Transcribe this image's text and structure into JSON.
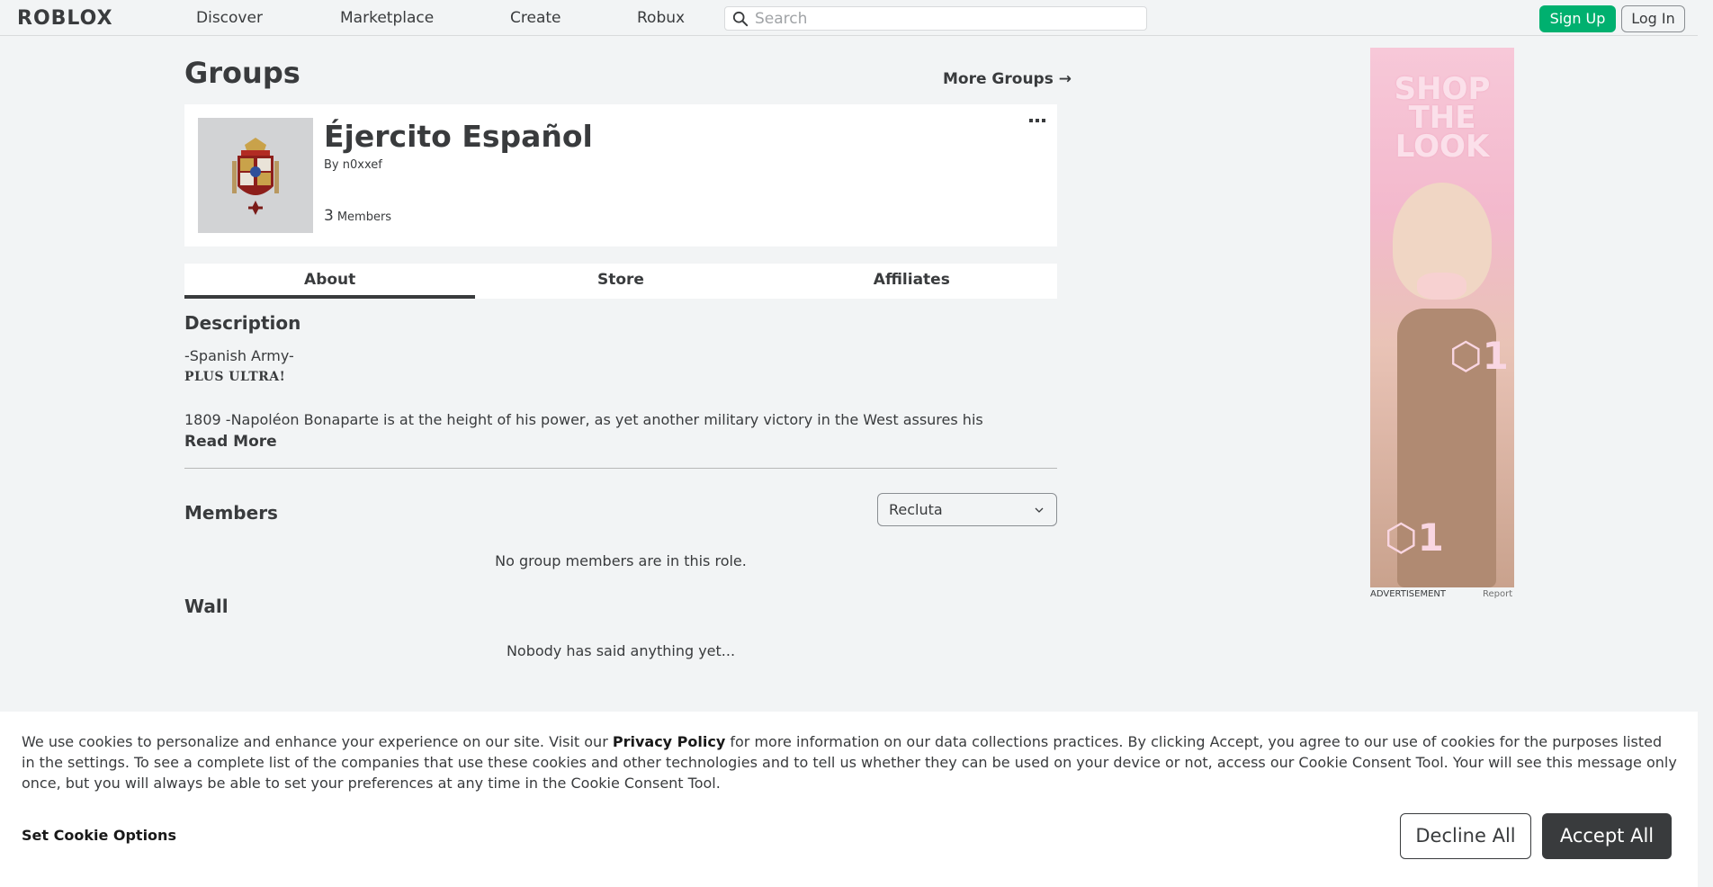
{
  "nav": {
    "logo": "ROBLOX",
    "links": [
      "Discover",
      "Marketplace",
      "Create",
      "Robux"
    ],
    "search_placeholder": "Search",
    "signup": "Sign Up",
    "login": "Log In"
  },
  "page": {
    "title": "Groups",
    "more_groups": "More Groups →"
  },
  "group": {
    "name": "Éjercito Español",
    "by_label": "By",
    "owner": "n0xxef",
    "member_count": "3",
    "members_label": "Members"
  },
  "tabs": [
    "About",
    "Store",
    "Affiliates"
  ],
  "description": {
    "title": "Description",
    "line1": "-Spanish Army-",
    "line2": "PLUS ULTRA!",
    "line3": "1809 -Napoléon Bonaparte is at the height of his power, as yet another military victory in the West assures his",
    "read_more": "Read More"
  },
  "members": {
    "title": "Members",
    "role_selected": "Recluta",
    "empty": "No group members are in this role."
  },
  "wall": {
    "title": "Wall",
    "empty": "Nobody has said anything yet..."
  },
  "ad": {
    "headline": "SHOP THE LOOK",
    "price1": "⬡1",
    "price2": "⬡1",
    "label": "ADVERTISEMENT",
    "report": "Report"
  },
  "cookie": {
    "text_before": "We use cookies to personalize and enhance your experience on our site. Visit our ",
    "privacy_link": "Privacy Policy",
    "text_after": " for more information on our data collections practices. By clicking Accept, you agree to our use of cookies for the purposes listed in the settings. To see a complete list of the companies that use these cookies and other technologies and to tell us whether they can be used on your device or not, access our Cookie Consent Tool. Your will see this message only once, but you will always be able to set your preferences at any time in the Cookie Consent Tool.",
    "set_options": "Set Cookie Options",
    "decline": "Decline All",
    "accept": "Accept All"
  },
  "colors": {
    "signup_green": "#00b06f",
    "text_dark": "#393b3d",
    "page_bg": "#f2f4f5"
  }
}
